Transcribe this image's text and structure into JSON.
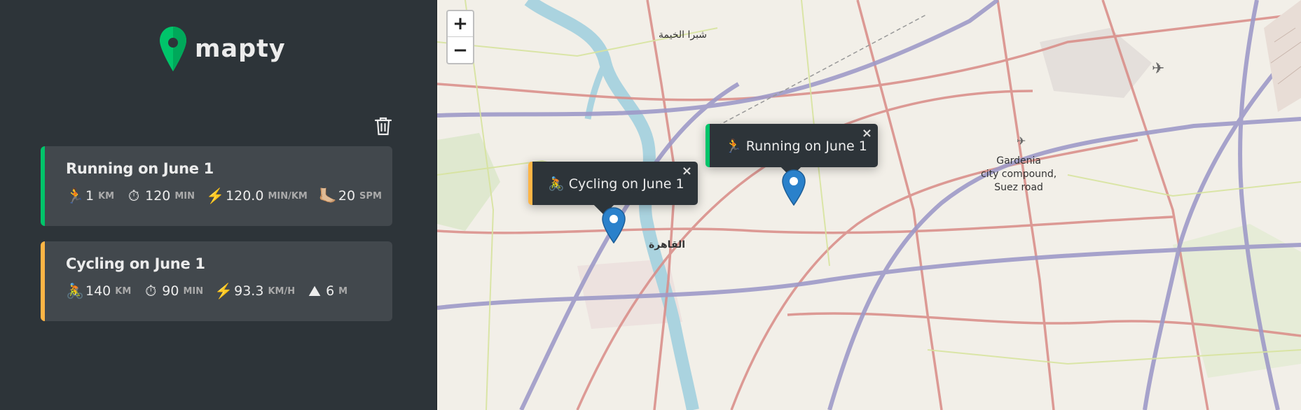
{
  "app": {
    "logo_text": "mapty"
  },
  "colors": {
    "running": "#00c46a",
    "cycling": "#ffb545",
    "sidebar": "#2d3439",
    "card": "#42484d",
    "marker": "#2a81cb"
  },
  "workouts": [
    {
      "type": "running",
      "title": "Running on June 1",
      "details": [
        {
          "icon": "🏃",
          "value": "1",
          "unit": "km"
        },
        {
          "icon": "⏱",
          "value": "120",
          "unit": "min"
        },
        {
          "icon": "⚡️",
          "value": "120.0",
          "unit": "min/km"
        },
        {
          "icon": "🦶🏼",
          "value": "20",
          "unit": "spm"
        }
      ]
    },
    {
      "type": "cycling",
      "title": "Cycling on June 1",
      "details": [
        {
          "icon": "🚴",
          "value": "140",
          "unit": "km"
        },
        {
          "icon": "⏱",
          "value": "90",
          "unit": "min"
        },
        {
          "icon": "⚡️",
          "value": "93.3",
          "unit": "km/h"
        },
        {
          "icon": "⛰",
          "value": "6",
          "unit": "m"
        }
      ]
    }
  ],
  "map": {
    "zoom_in": "+",
    "zoom_out": "−",
    "popups": [
      {
        "icon": "🏃",
        "text": "Running on June 1",
        "close": "×"
      },
      {
        "icon": "🚴",
        "text": "Cycling on June 1",
        "close": "×"
      }
    ],
    "labels": {
      "gardenia": "Gardenia\ncity compound,\nSuez road",
      "cairo": "القاهرة",
      "shubra": "شبرا الخيمة"
    }
  }
}
